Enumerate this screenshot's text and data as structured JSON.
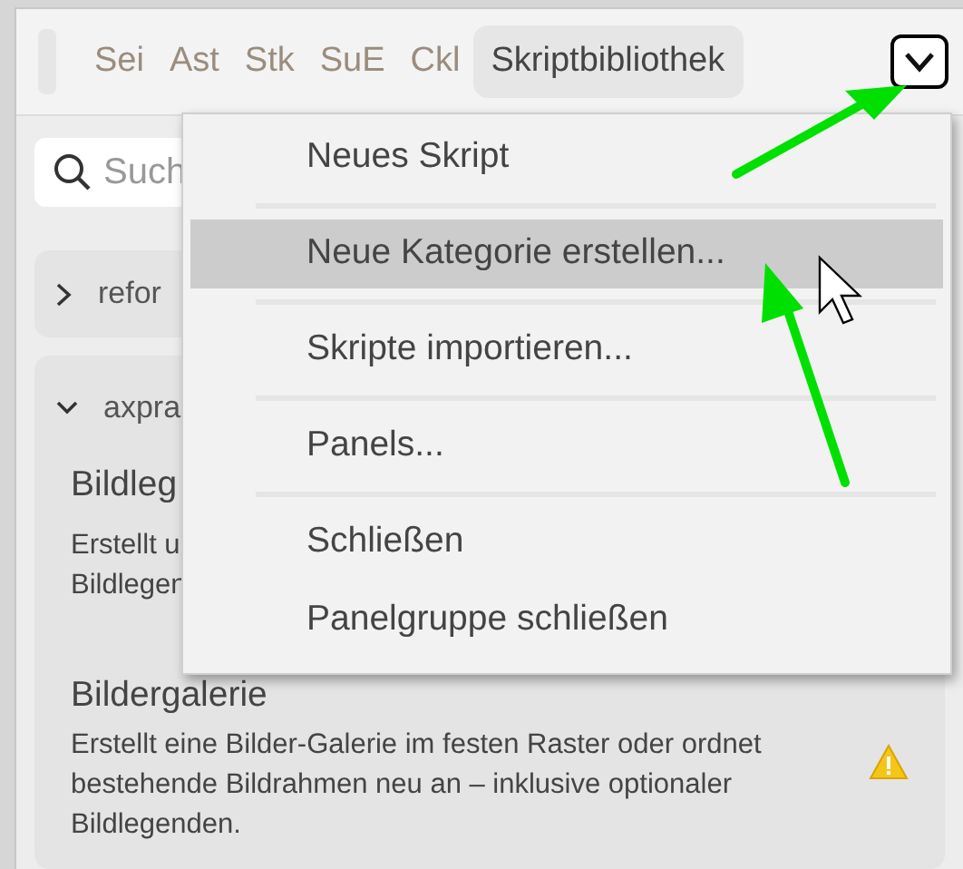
{
  "tabs": [
    {
      "label": "Sei",
      "selected": false
    },
    {
      "label": "Ast",
      "selected": false
    },
    {
      "label": "Stk",
      "selected": false
    },
    {
      "label": "SuE",
      "selected": false
    },
    {
      "label": "Ckl",
      "selected": false
    },
    {
      "label": "Skriptbibliothek",
      "selected": true
    }
  ],
  "search": {
    "placeholder": "Such"
  },
  "groups": [
    {
      "name": "refor",
      "expanded": false
    },
    {
      "name": "axpra",
      "expanded": true,
      "scripts": [
        {
          "title": "Bildleg",
          "description": [
            "Erstellt u",
            "Bildlegen"
          ]
        },
        {
          "title": "Bildergalerie",
          "description": [
            "Erstellt eine Bilder-Galerie im festen Raster oder ordnet",
            "bestehende Bildrahmen neu an – inklusive optionaler",
            "Bildlegenden."
          ],
          "warning": true
        }
      ]
    }
  ],
  "menu": {
    "items": [
      {
        "label": "Neues Skript",
        "selected": false,
        "divider_after": true
      },
      {
        "label": "Neue Kategorie erstellen...",
        "selected": true,
        "divider_after": true
      },
      {
        "label": "Skripte importieren...",
        "selected": false,
        "divider_after": true
      },
      {
        "label": "Panels...",
        "selected": false,
        "divider_after": true
      },
      {
        "label": "Schließen",
        "selected": false,
        "divider_after": false
      },
      {
        "label": "Panelgruppe schließen",
        "selected": false,
        "divider_after": false
      }
    ]
  }
}
